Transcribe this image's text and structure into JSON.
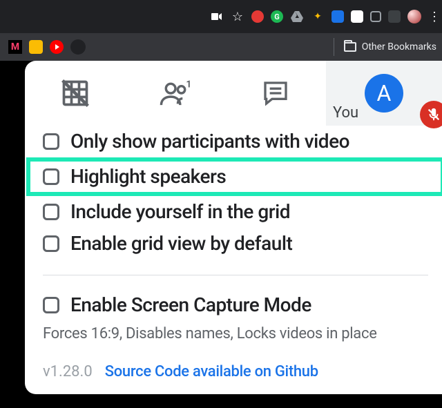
{
  "browser": {
    "other_bookmarks_label": "Other Bookmarks"
  },
  "tile": {
    "you_label": "You",
    "avatar_initial": "A"
  },
  "options": {
    "only_video": "Only show participants with video",
    "highlight_speakers": "Highlight speakers",
    "include_self": "Include yourself in the grid",
    "enable_default": "Enable grid view by default",
    "screen_capture": "Enable Screen Capture Mode",
    "screen_capture_hint": "Forces 16:9, Disables names, Locks videos in place"
  },
  "footer": {
    "version": "v1.28.0",
    "source_link": "Source Code available on Github"
  }
}
